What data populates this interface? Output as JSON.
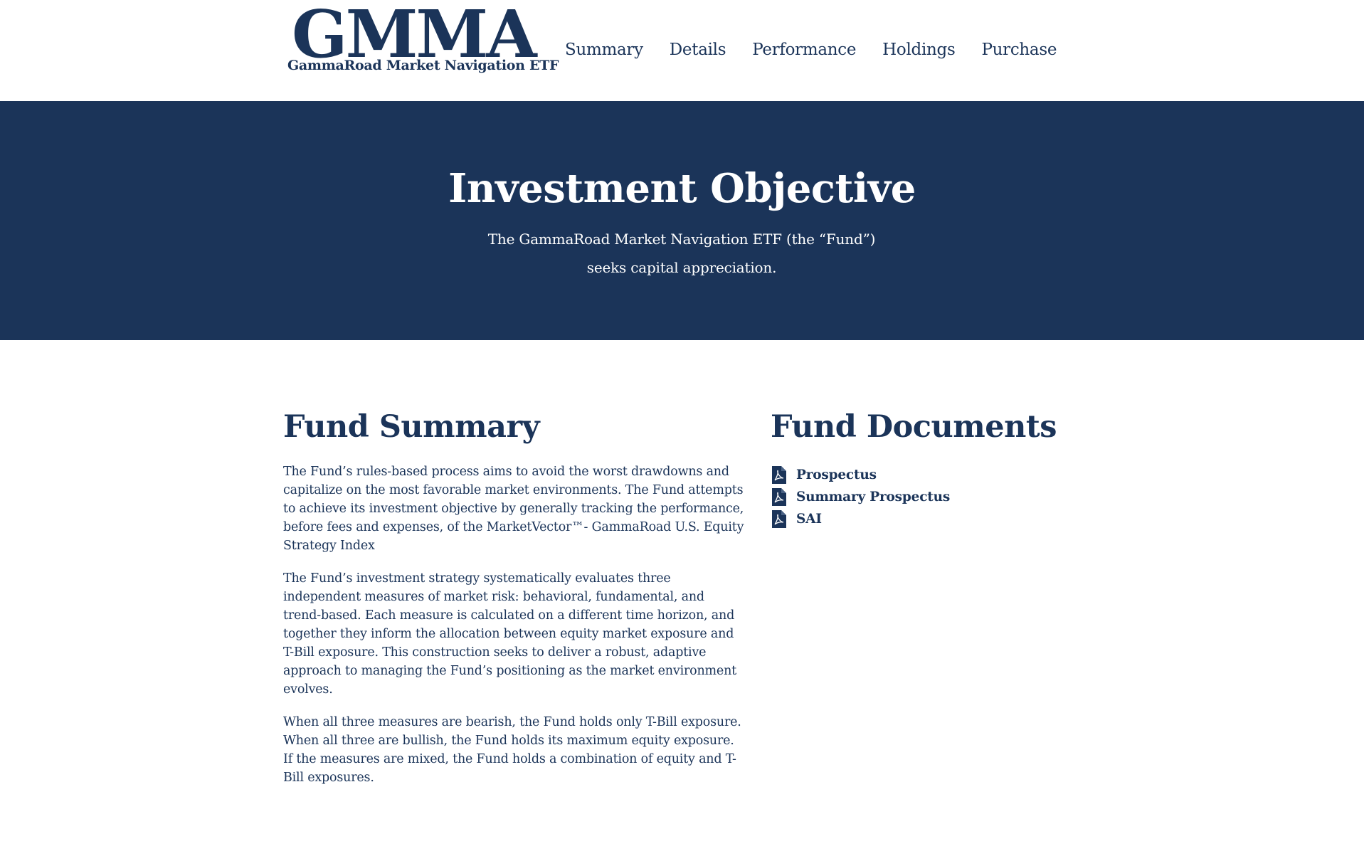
{
  "brand": {
    "logo_text": "GMMA",
    "tagline": "GammaRoad Market Navigation ETF"
  },
  "nav": {
    "items": [
      {
        "label": "Summary"
      },
      {
        "label": "Details"
      },
      {
        "label": "Performance"
      },
      {
        "label": "Holdings"
      },
      {
        "label": "Purchase"
      }
    ]
  },
  "hero": {
    "title": "Investment Objective",
    "text": "The GammaRoad Market Navigation ETF (the “Fund”) seeks capital appreciation."
  },
  "fund_summary": {
    "title": "Fund Summary",
    "paragraphs": [
      "The Fund’s rules-based process aims to avoid the worst drawdowns and capitalize on the most favorable market environments. The Fund attempts to achieve its investment objective by generally tracking the performance, before fees and expenses, of the MarketVector™- GammaRoad U.S. Equity Strategy Index",
      "The Fund’s investment strategy systematically evaluates three independent measures of market risk: behavioral, fundamental, and trend-based. Each measure is calculated on a different time horizon, and together they inform the allocation between equity market exposure and T-Bill exposure. This construction seeks to deliver a robust, adaptive approach to managing the Fund’s positioning as the market environment evolves.",
      "When all three measures are bearish, the Fund holds only T-Bill exposure. When all three are bullish, the Fund holds its maximum equity exposure. If the measures are mixed, the Fund holds a combination of equity and T-Bill exposures."
    ]
  },
  "fund_documents": {
    "title": "Fund Documents",
    "items": [
      {
        "label": "Prospectus",
        "icon": "pdf-icon"
      },
      {
        "label": "Summary Prospectus",
        "icon": "pdf-icon"
      },
      {
        "label": "SAI",
        "icon": "pdf-icon"
      }
    ]
  },
  "colors": {
    "navy": "#1b3459",
    "white": "#ffffff"
  }
}
